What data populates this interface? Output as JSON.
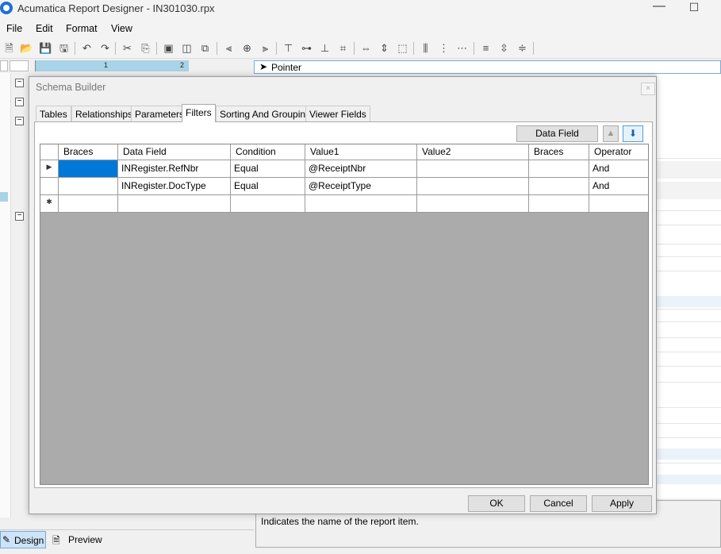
{
  "window": {
    "title": "Acumatica Report Designer - IN301030.rpx",
    "minimize": "—",
    "maximize": "☐"
  },
  "menu": [
    "File",
    "Edit",
    "Format",
    "View"
  ],
  "ruler": {
    "mark1": "1",
    "mark2": "2"
  },
  "pointer_panel": {
    "label": "Pointer"
  },
  "dialog": {
    "title": "Schema Builder",
    "close": "×",
    "tabs": [
      "Tables",
      "Relationships",
      "Parameters",
      "Filters",
      "Sorting And Grouping",
      "Viewer Fields"
    ],
    "active_tab": "Filters",
    "data_field_formula_button": "Data Field Formula",
    "move_up_icon": "▲",
    "move_down_icon": "⬇",
    "grid": {
      "columns": [
        "Braces",
        "Data Field",
        "Condition",
        "Value1",
        "Value2",
        "Braces",
        "Operator"
      ],
      "rows": [
        {
          "indicator": "▶",
          "cells": [
            "",
            "INRegister.RefNbr",
            "Equal",
            "@ReceiptNbr",
            "",
            "",
            "And"
          ]
        },
        {
          "indicator": "",
          "cells": [
            "",
            "INRegister.DocType",
            "Equal",
            "@ReceiptType",
            "",
            "",
            "And"
          ]
        },
        {
          "indicator": "✱",
          "cells": [
            "",
            "",
            "",
            "",
            "",
            "",
            ""
          ]
        }
      ]
    },
    "buttons": {
      "ok": "OK",
      "cancel": "Cancel",
      "apply": "Apply"
    }
  },
  "bottom": {
    "design_tab": "Design",
    "preview_tab": "Preview",
    "description": "Indicates the name of the report item."
  },
  "colors": {
    "selection": "#0078d7",
    "grid_empty": "#ababab",
    "accent": "#1e6fd6"
  }
}
